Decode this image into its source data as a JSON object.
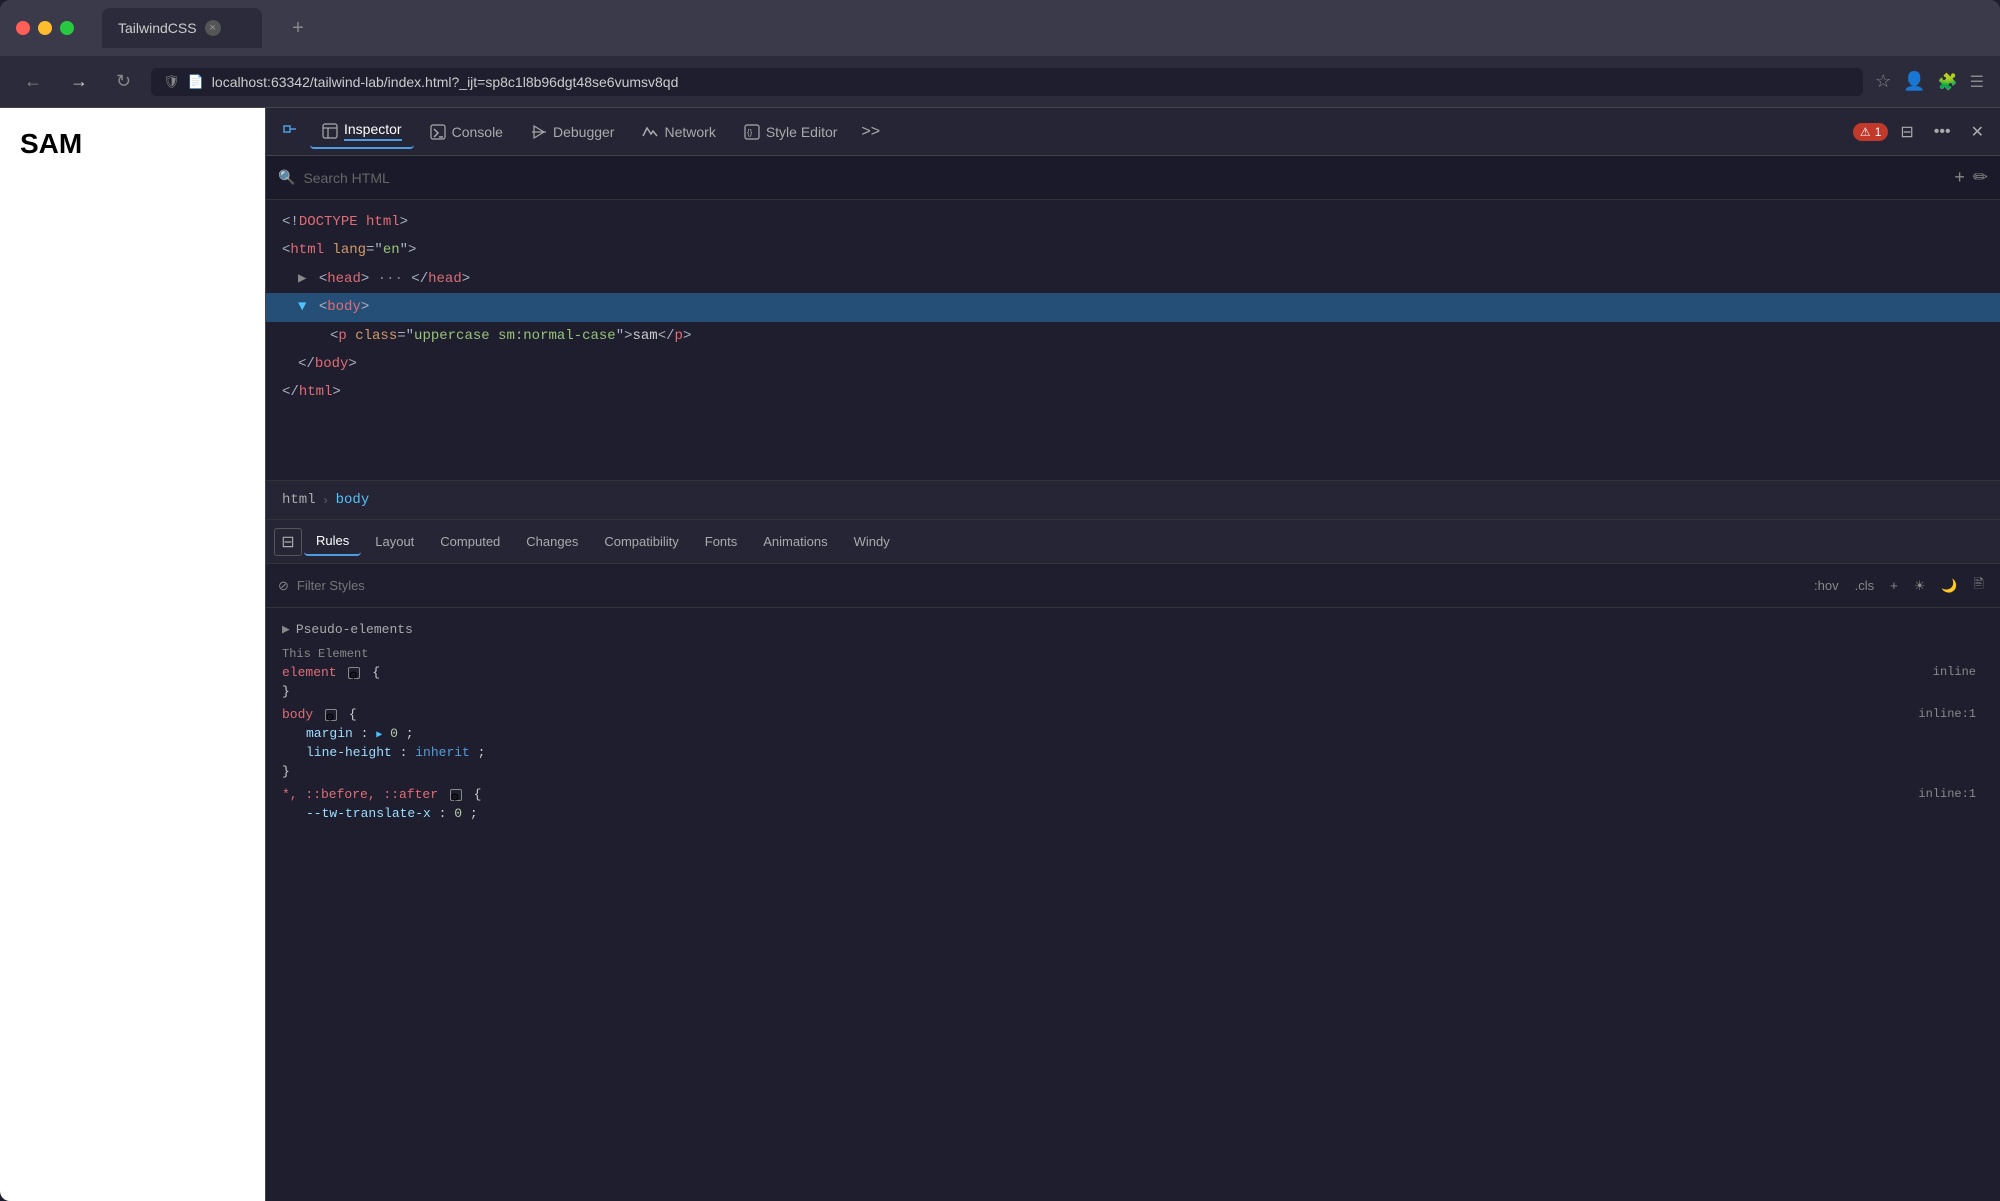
{
  "browser": {
    "tab_title": "TailwindCSS",
    "tab_close": "×",
    "tab_add": "+",
    "url": "localhost:63342/tailwind-lab/index.html?_ijt=sp8c1l8b96dgt48se6vumsv8qd",
    "url_protocol": "localhost:",
    "url_path": "63342/tailwind-lab/index.html?_ijt=sp8c1l8b96dgt48se6vumsv8qd"
  },
  "page": {
    "sam_text": "SAM"
  },
  "devtools": {
    "tabs": [
      {
        "label": "Inspector",
        "active": true,
        "icon": "inspector"
      },
      {
        "label": "Console",
        "active": false,
        "icon": "console"
      },
      {
        "label": "Debugger",
        "active": false,
        "icon": "debugger"
      },
      {
        "label": "Network",
        "active": false,
        "icon": "network"
      },
      {
        "label": "Style Editor",
        "active": false,
        "icon": "style-editor"
      }
    ],
    "more_label": ">>",
    "error_count": "1",
    "search_placeholder": "Search HTML",
    "html_tree": [
      {
        "indent": 0,
        "content": "<!DOCTYPE html>",
        "type": "doctype",
        "selected": false
      },
      {
        "indent": 0,
        "content": "<html lang=\"en\">",
        "type": "open-tag",
        "selected": false
      },
      {
        "indent": 1,
        "content": "▶ <head>···</head>",
        "type": "collapsed",
        "selected": false
      },
      {
        "indent": 1,
        "content": "▼ <body>",
        "type": "open-selected",
        "selected": true
      },
      {
        "indent": 2,
        "content": "<p class=\"uppercase sm:normal-case\">sam</p>",
        "type": "element",
        "selected": false
      },
      {
        "indent": 1,
        "content": "</body>",
        "type": "close-tag",
        "selected": false
      },
      {
        "indent": 0,
        "content": "</html>",
        "type": "close-tag",
        "selected": false
      }
    ],
    "breadcrumb": [
      {
        "label": "html",
        "active": false
      },
      {
        "label": "body",
        "active": true
      }
    ],
    "style_tabs": [
      {
        "label": "Rules",
        "active": true
      },
      {
        "label": "Layout",
        "active": false
      },
      {
        "label": "Computed",
        "active": false
      },
      {
        "label": "Changes",
        "active": false
      },
      {
        "label": "Compatibility",
        "active": false
      },
      {
        "label": "Fonts",
        "active": false
      },
      {
        "label": "Animations",
        "active": false
      },
      {
        "label": "Windy",
        "active": false
      }
    ],
    "filter_placeholder": "Filter Styles",
    "filter_hov": ":hov",
    "filter_cls": ".cls",
    "pseudo_elements_label": "Pseudo-elements",
    "this_element_label": "This Element",
    "css_rules": [
      {
        "selector": "element",
        "icon": true,
        "source": "inline",
        "props": [],
        "empty": true
      },
      {
        "selector": "body",
        "icon": true,
        "source": "inline:1",
        "props": [
          {
            "name": "margin",
            "colon": ":",
            "value": "0",
            "value_type": "number",
            "arrow": true,
            "semicolon": ";"
          },
          {
            "name": "line-height",
            "colon": ":",
            "value": "inherit",
            "value_type": "keyword",
            "arrow": false,
            "semicolon": ";"
          }
        ]
      },
      {
        "selector": "*, ::before, ::after",
        "icon": true,
        "source": "inline:1",
        "props": [
          {
            "name": "--tw-translate-x",
            "colon": ":",
            "value": "0",
            "value_type": "number",
            "arrow": false,
            "semicolon": ";"
          }
        ],
        "truncated": true
      }
    ]
  }
}
